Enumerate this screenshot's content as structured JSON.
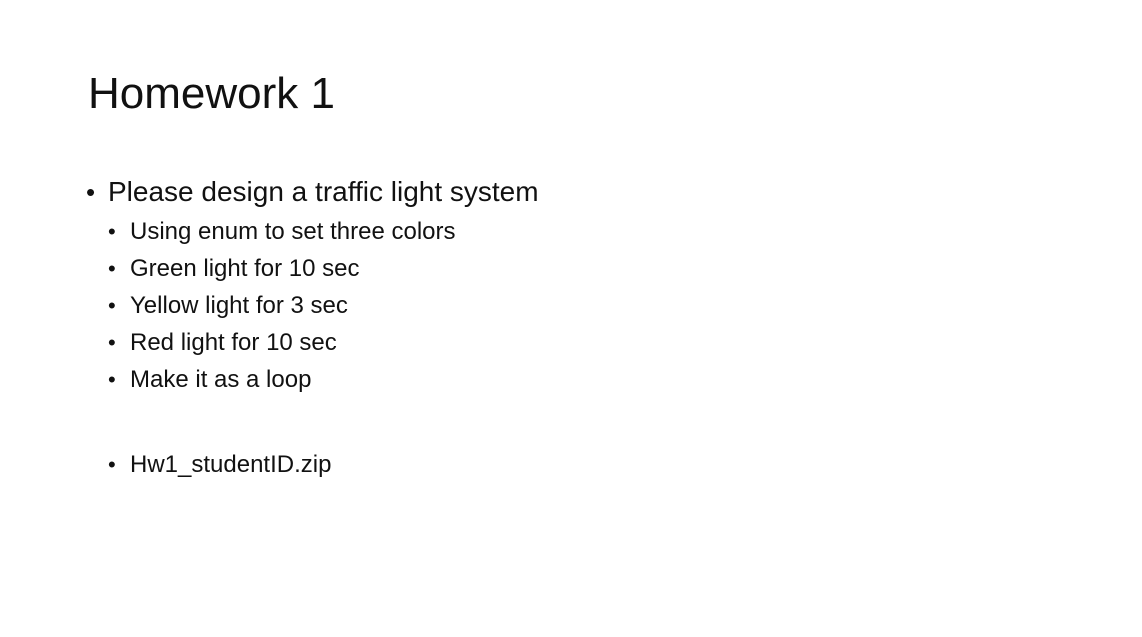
{
  "slide": {
    "title": "Homework 1",
    "bullets": [
      {
        "text": "Please design a traffic light system",
        "subitems": [
          "Using enum to set three colors",
          "Green light for 10 sec",
          "Yellow light for 3 sec",
          "Red light for 10 sec",
          "Make it as a loop"
        ]
      }
    ],
    "extra_subitem": "Hw1_studentID.zip",
    "bullet_glyph": "•"
  }
}
